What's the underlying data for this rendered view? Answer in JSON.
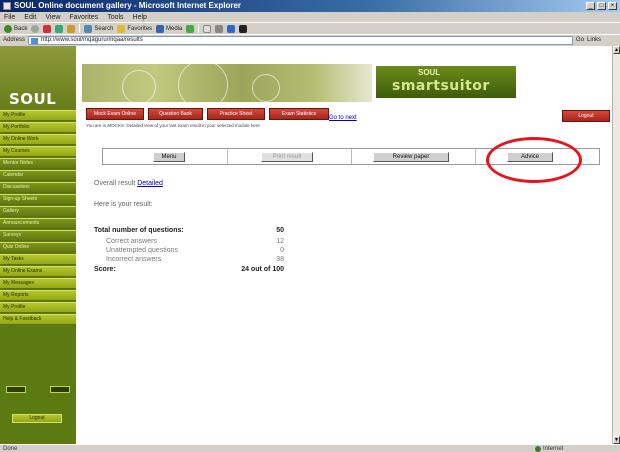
{
  "window": {
    "title": "SOUL Online document gallery - Microsoft Internet Explorer"
  },
  "menu": [
    "File",
    "Edit",
    "View",
    "Favorites",
    "Tools",
    "Help"
  ],
  "toolbar": [
    "Back",
    "Forward",
    "Stop",
    "Refresh",
    "Home",
    "Search",
    "Favorites",
    "Media",
    "History",
    "Mail",
    "Print",
    "Edit"
  ],
  "address": {
    "label": "Address",
    "value": "http://www.soul/mqaguru/mqaa/results",
    "go": "Go",
    "links": "Links"
  },
  "banner": {
    "logo_small": "SOUL",
    "logo_top": "SOUL",
    "logo_main": "smartsuitor"
  },
  "nav": {
    "items": [
      "My Profile",
      "My Portfolio",
      "My Online Work",
      "My Courses",
      "Mentor Notes",
      "Calendar",
      "Discussions",
      "Sign-up Sheets",
      "Gallery",
      "Announcements",
      "Surveys",
      "Quiz Online",
      "My Tasks",
      "My Online Exams",
      "My Messages",
      "My Reports",
      "My Profile",
      "Help & Feedback"
    ],
    "logout": "Logout"
  },
  "tabs": [
    "Mock Exam Online",
    "Question Bank",
    "Practice Sheet",
    "Exam Statistics"
  ],
  "tab_link": "Go to next",
  "logout_button": "Logout",
  "path_text": "You are in MOCKS: Detailed view of your last exam result in your selected module here",
  "actions": {
    "menu": "Menu",
    "print": "Print result",
    "review": "Review paper",
    "advice": "Advice"
  },
  "overall": {
    "label": "Overall result",
    "link": "Detailed"
  },
  "here": "Here is your result:",
  "results": {
    "total": {
      "label": "Total number of questions:",
      "value": "50"
    },
    "correct": {
      "label": "Correct answers",
      "value": "12"
    },
    "unattempted": {
      "label": "Unattempted questions",
      "value": "0"
    },
    "incorrect": {
      "label": "Incorrect answers",
      "value": "38"
    },
    "score": {
      "label": "Score:",
      "value": "24 out of 100"
    }
  },
  "status": {
    "left": "Done",
    "zone": "Internet"
  }
}
